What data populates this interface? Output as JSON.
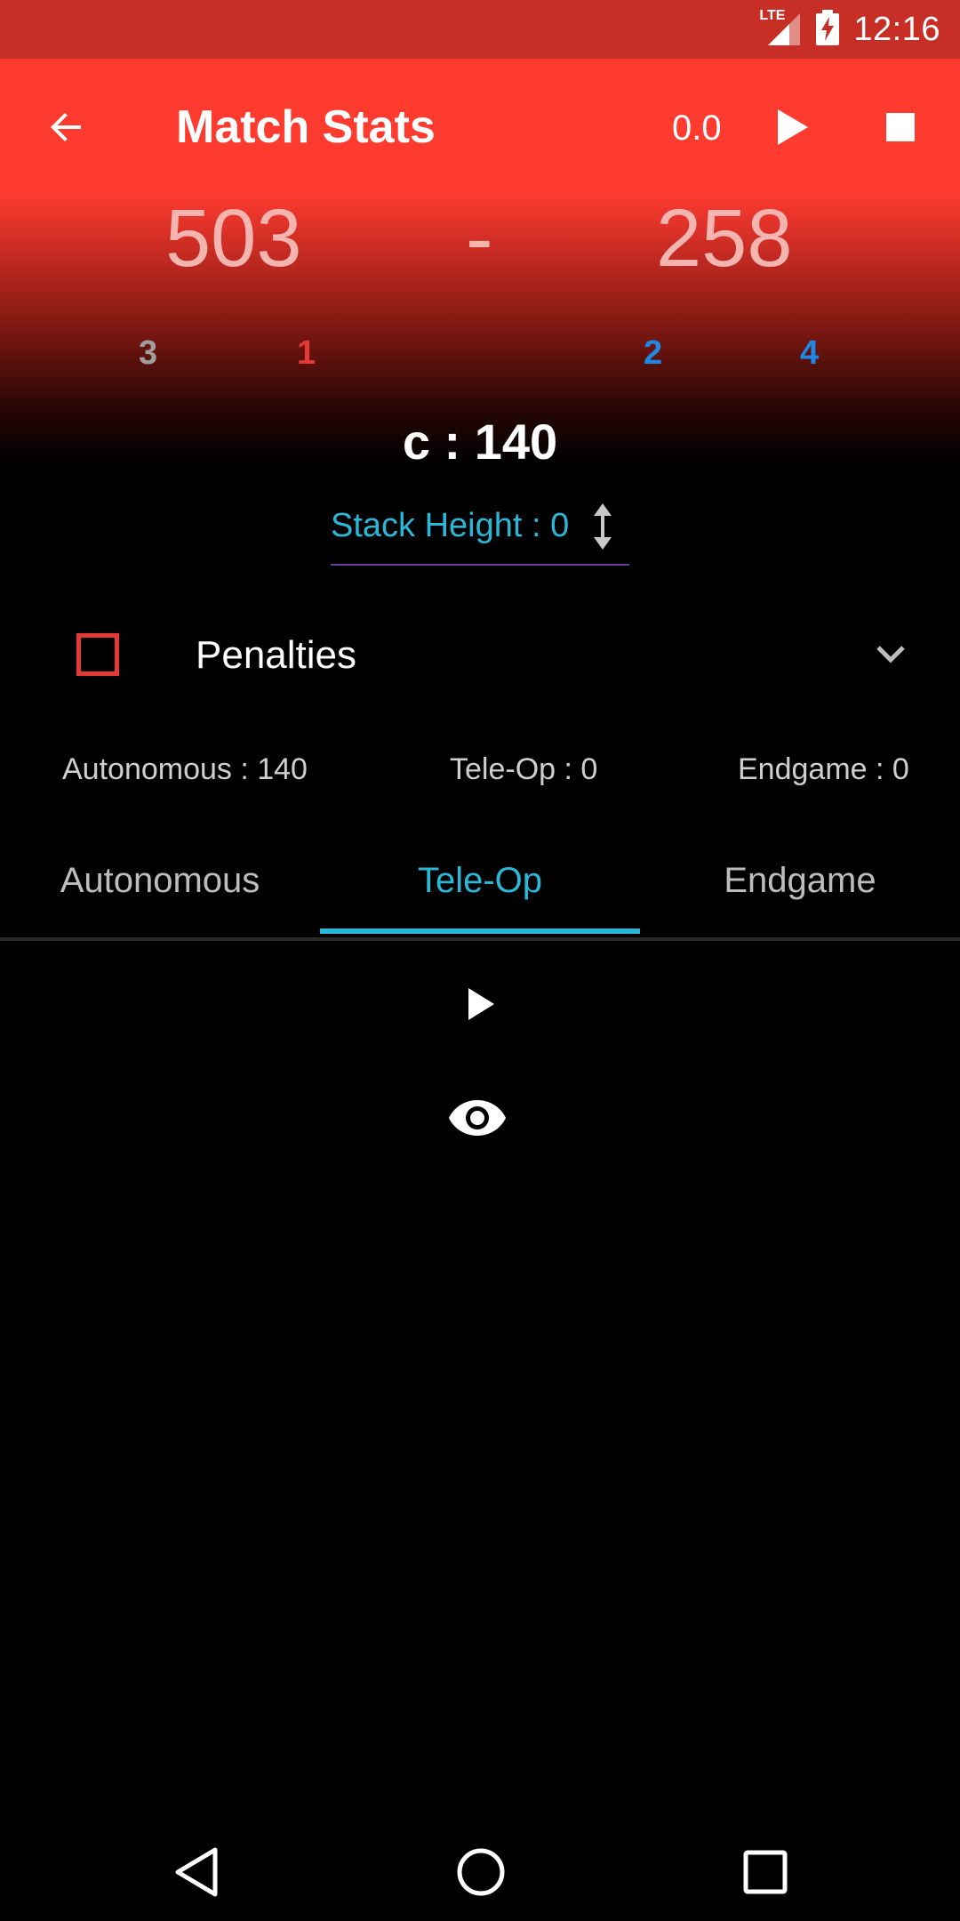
{
  "status_bar": {
    "network": "LTE",
    "time": "12:16"
  },
  "toolbar": {
    "title": "Match Stats",
    "timer": "0.0"
  },
  "scores": {
    "red": "503",
    "separator": "-",
    "blue": "258"
  },
  "teams": {
    "red": [
      {
        "number": "3",
        "color": "#9e9e9e"
      },
      {
        "number": "1",
        "color": "#e53935"
      }
    ],
    "blue": [
      {
        "number": "2",
        "color": "#1e88e5"
      },
      {
        "number": "4",
        "color": "#1e88e5"
      }
    ]
  },
  "centre_stat": "c : 140",
  "stack_height": {
    "label": "Stack Height : 0"
  },
  "penalties": {
    "label": "Penalties",
    "checked": false
  },
  "summary": {
    "autonomous": "Autonomous : 140",
    "teleop": "Tele-Op : 0",
    "endgame": "Endgame : 0"
  },
  "tabs": [
    {
      "label": "Autonomous",
      "active": false
    },
    {
      "label": "Tele-Op",
      "active": true
    },
    {
      "label": "Endgame",
      "active": false
    }
  ],
  "colors": {
    "primary": "#ff3b30",
    "status_bar": "#c62e26",
    "accent": "#2ab7d8",
    "red_alliance": "#e53935",
    "blue_alliance": "#1e88e5"
  },
  "icons": {
    "back": "arrow-left-icon",
    "play": "play-icon",
    "stop": "stop-icon",
    "stack": "vertical-arrows-icon",
    "chevron": "chevron-down-icon",
    "eye": "eye-icon",
    "nav_back": "triangle-back-icon",
    "nav_home": "circle-home-icon",
    "nav_recents": "square-recents-icon"
  }
}
